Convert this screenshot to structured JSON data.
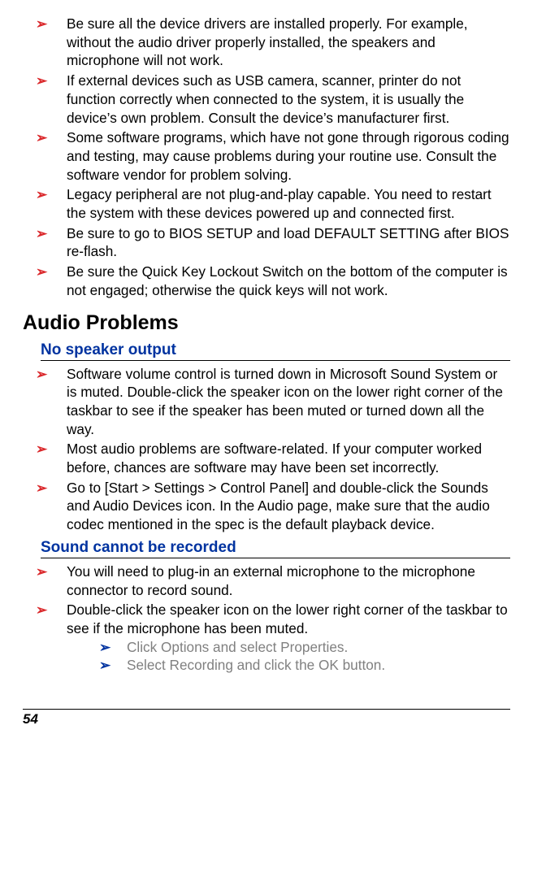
{
  "top_bullets": [
    "Be sure all the device drivers are installed properly. For example, without the audio driver properly installed, the speakers and microphone will not work.",
    "If external devices such as USB camera, scanner, printer do not function correctly when connected to the system, it is usually the device’s own problem. Consult the device’s manufacturer first.",
    "Some software programs, which have not gone through rigorous coding and testing, may cause problems during your routine use. Consult the software vendor for problem solving.",
    "Legacy peripheral are not plug-and-play capable. You need to restart the system with these devices powered up and connected first.",
    "Be sure to go to BIOS SETUP and load DEFAULT SETTING after BIOS re-flash.",
    "Be sure the Quick Key Lockout Switch on the bottom of the computer is not engaged; otherwise the quick keys will not work."
  ],
  "h1": "Audio Problems",
  "sections": [
    {
      "title": "No speaker output",
      "bullets": [
        "Software volume control is turned down in Microsoft Sound System or is muted. Double-click the speaker icon on the lower right corner of the taskbar to see if the speaker has been muted or turned down all the way.",
        "Most audio problems are software-related. If your computer worked before, chances are software may have been set incorrectly.",
        "Go to [Start > Settings > Control Panel] and double-click the Sounds and Audio Devices icon. In the Audio page, make sure that the audio codec mentioned in the spec is the default playback device."
      ]
    },
    {
      "title": "Sound cannot be recorded",
      "bullets": [
        "You will need to plug-in an external microphone to the microphone connector to record sound.",
        "Double-click the speaker icon on the lower right corner of the taskbar to see if the microphone has been muted."
      ],
      "sub_bullets": [
        "Click Options and select Properties.",
        "Select Recording and click the OK button."
      ]
    }
  ],
  "page_number": "54",
  "arrow": "➢"
}
